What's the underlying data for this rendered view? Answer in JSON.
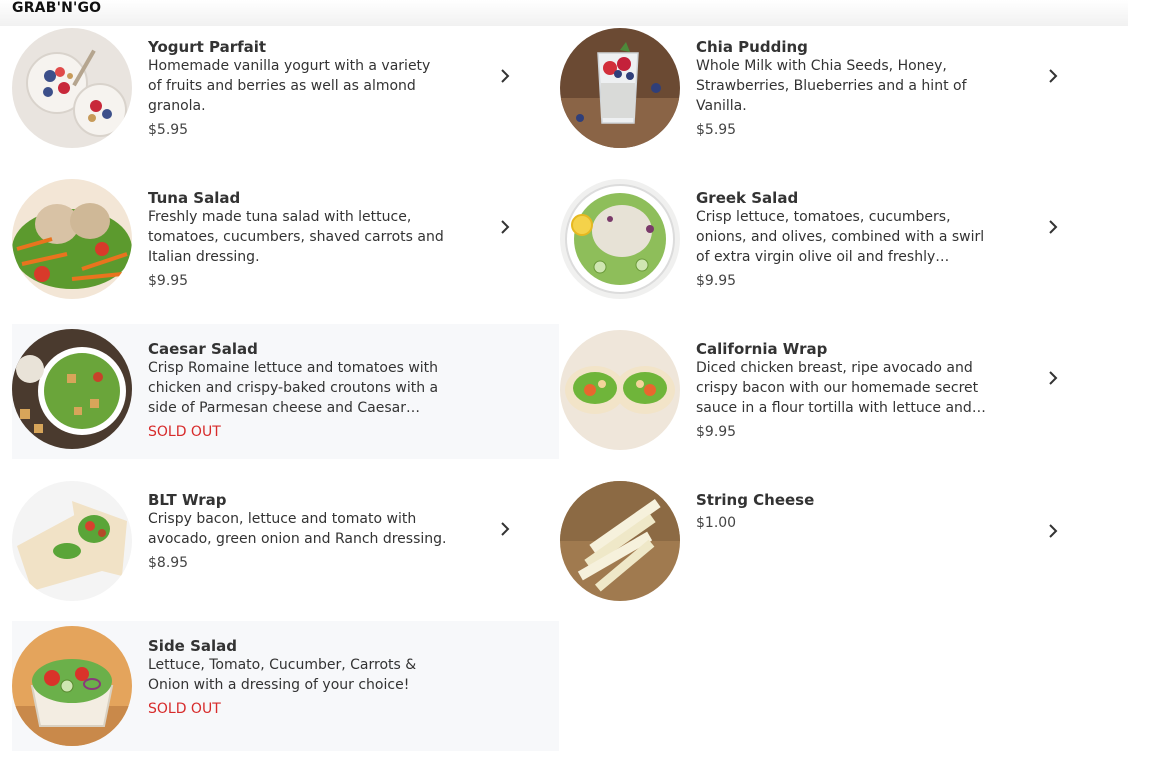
{
  "section": {
    "title": "GRAB'N'GO"
  },
  "items": [
    {
      "name": "Yogurt Parfait",
      "description": "Homemade vanilla yogurt with a variety of fruits and berries as well as almond granola.",
      "price": "$5.95",
      "icon": "yogurt-parfait-image"
    },
    {
      "name": "Chia Pudding",
      "description": "Whole Milk with Chia Seeds, Honey, Strawberries, Blueberries and a hint of Vanilla.",
      "price": "$5.95",
      "icon": "chia-pudding-image"
    },
    {
      "name": "Tuna Salad",
      "description": "Freshly made tuna salad with lettuce, tomatoes, cucumbers, shaved carrots and Italian dressing.",
      "price": "$9.95",
      "icon": "tuna-salad-image"
    },
    {
      "name": "Greek Salad",
      "description": "Crisp lettuce, tomatoes, cucumbers, onions, and olives, combined with a swirl of extra virgin olive oil and freshly squeezed lemon juice.",
      "price": "$9.95",
      "icon": "greek-salad-image"
    },
    {
      "name": "Caesar Salad",
      "description": "Crisp Romaine lettuce and tomatoes with chicken and crispy-baked croutons with a side of Parmesan cheese and Caesar dressing.",
      "price": "SOLD OUT",
      "icon": "caesar-salad-image"
    },
    {
      "name": "California Wrap",
      "description": "Diced chicken breast, ripe avocado and crispy bacon with our homemade secret sauce in a flour tortilla with lettuce and tomato.",
      "price": "$9.95",
      "icon": "california-wrap-image"
    },
    {
      "name": "BLT Wrap",
      "description": "Crispy bacon, lettuce and tomato with avocado, green onion and Ranch dressing.",
      "price": "$8.95",
      "icon": "blt-wrap-image"
    },
    {
      "name": "String Cheese",
      "description": "",
      "price": "$1.00",
      "icon": "string-cheese-image"
    },
    {
      "name": "Side Salad",
      "description": "Lettuce, Tomato, Cucumber, Carrots & Onion with a dressing of your choice!",
      "price": "SOLD OUT",
      "icon": "side-salad-image"
    }
  ],
  "colors": {
    "sold_out": "#d72b2b",
    "sold_out_bg": "#f7f8fa",
    "chevron": "#333333"
  }
}
